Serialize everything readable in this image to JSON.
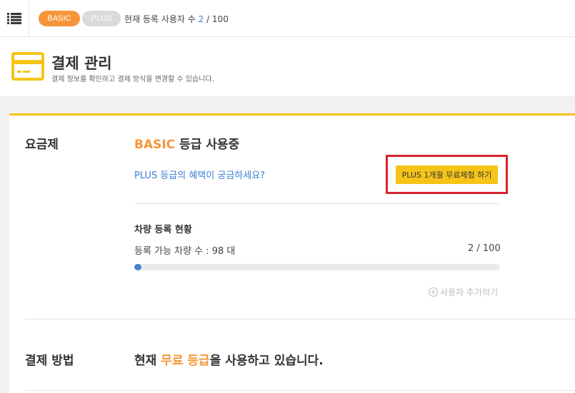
{
  "topbar": {
    "menu_icon": "list-menu-icon",
    "badge_basic": "BASIC",
    "badge_plus": "PLUS",
    "user_count_label": "현재 등록 사용자 수",
    "user_count_current": "2",
    "user_count_total": "/ 100"
  },
  "header": {
    "icon": "credit-card-icon",
    "title": "결제 관리",
    "description": "결제 정보를 확인하고 결제 방식을 변경할 수 있습니다."
  },
  "plan": {
    "label": "요금제",
    "grade": "BASIC",
    "grade_suffix": "등급 사용중",
    "benefit_link": "PLUS 등급의 혜택이 궁금하세요?",
    "trial_button": "PLUS 1개월 무료체험 하기"
  },
  "registration": {
    "title": "차량 등록 현황",
    "available": "등록 가능 차량 수 : 98 대",
    "ratio": "2 / 100",
    "progress_fraction": 0.02,
    "add_user": "사용자 추가하기"
  },
  "payment": {
    "label": "결제 방법",
    "text_prefix": "현재",
    "text_accent": "무료 등급",
    "text_suffix": "을 사용하고 있습니다."
  },
  "colors": {
    "accent_orange": "#f5963a",
    "accent_yellow": "#f6c418",
    "link_blue": "#3b7fd3",
    "highlight_red": "#d9232d"
  }
}
